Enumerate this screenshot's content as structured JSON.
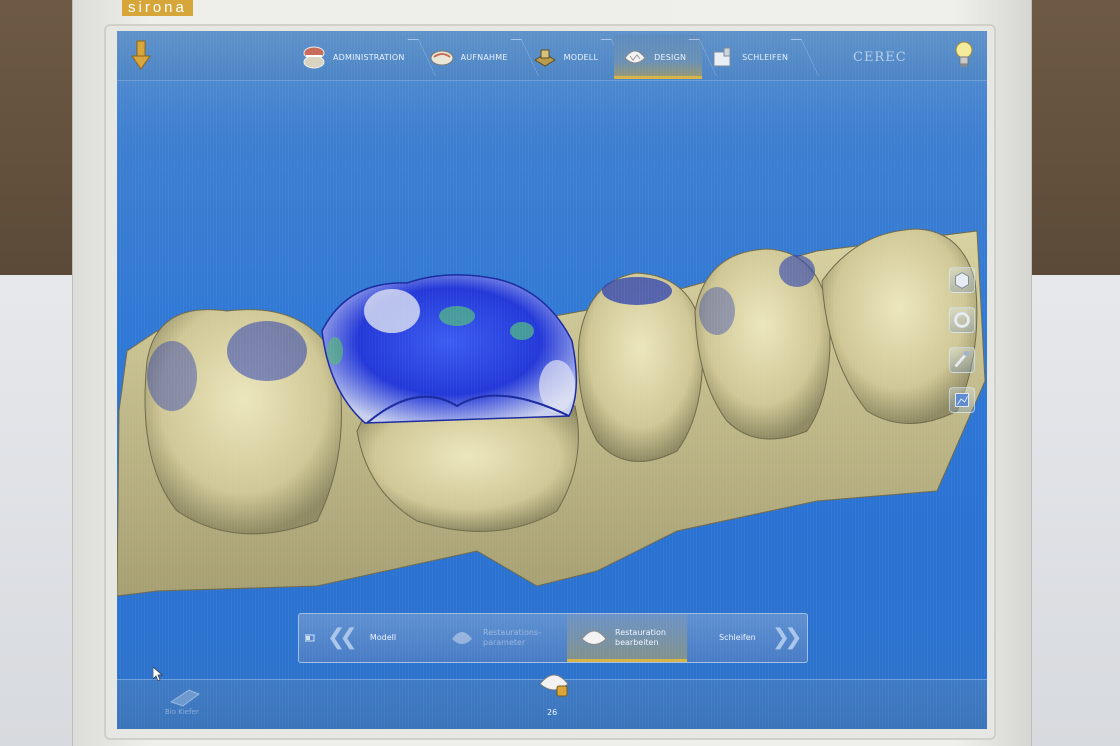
{
  "brand": {
    "label": "sirona"
  },
  "top_bar": {
    "steps": [
      {
        "label": "ADMINISTRATION",
        "icon": "jaw-icon"
      },
      {
        "label": "AUFNAHME",
        "icon": "scan-icon"
      },
      {
        "label": "MODELL",
        "icon": "model-icon"
      },
      {
        "label": "DESIGN",
        "icon": "design-icon",
        "active": true
      },
      {
        "label": "SCHLEIFEN",
        "icon": "milling-icon"
      }
    ],
    "product_label": "CEREC"
  },
  "sub_bar": {
    "back_label": "Modell",
    "items": [
      {
        "label": "Restaurations-\nparameter",
        "state": "disabled"
      },
      {
        "label": "Restauration\nbearbeiten",
        "state": "active"
      }
    ],
    "next_label": "Schleifen"
  },
  "bottom_bar": {
    "jaw_label": "Bio Kiefer",
    "tooth_number": "26"
  },
  "colors": {
    "screen_blue": "#2f78d6",
    "active_step_accent": "#d7b447",
    "tooth_base": "#d9d3a4",
    "crown_blue": "#1f3fd8"
  }
}
